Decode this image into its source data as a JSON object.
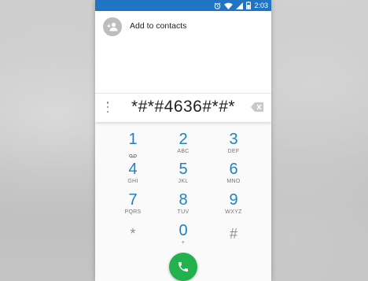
{
  "status_bar": {
    "time": "2:03"
  },
  "add_contact": {
    "label": "Add to contacts"
  },
  "dialer": {
    "entered_digits": "*#*#4636#*#*"
  },
  "keypad": {
    "keys": [
      {
        "digit": "1",
        "letters": ""
      },
      {
        "digit": "2",
        "letters": "ABC"
      },
      {
        "digit": "3",
        "letters": "DEF"
      },
      {
        "digit": "4",
        "letters": "GHI"
      },
      {
        "digit": "5",
        "letters": "JKL"
      },
      {
        "digit": "6",
        "letters": "MNO"
      },
      {
        "digit": "7",
        "letters": "PQRS"
      },
      {
        "digit": "8",
        "letters": "TUV"
      },
      {
        "digit": "9",
        "letters": "WXYZ"
      },
      {
        "digit": "*",
        "letters": ""
      },
      {
        "digit": "0",
        "letters": "+"
      },
      {
        "digit": "#",
        "letters": ""
      }
    ]
  },
  "colors": {
    "status_bar": "#1f75c4",
    "digit_accent": "#1f81c4",
    "call_button": "#22b14c"
  },
  "icons": [
    "alarm-icon",
    "wifi-icon",
    "signal-icon",
    "battery-icon",
    "add-person-icon",
    "overflow-menu-icon",
    "backspace-icon",
    "voicemail-icon",
    "phone-icon"
  ]
}
